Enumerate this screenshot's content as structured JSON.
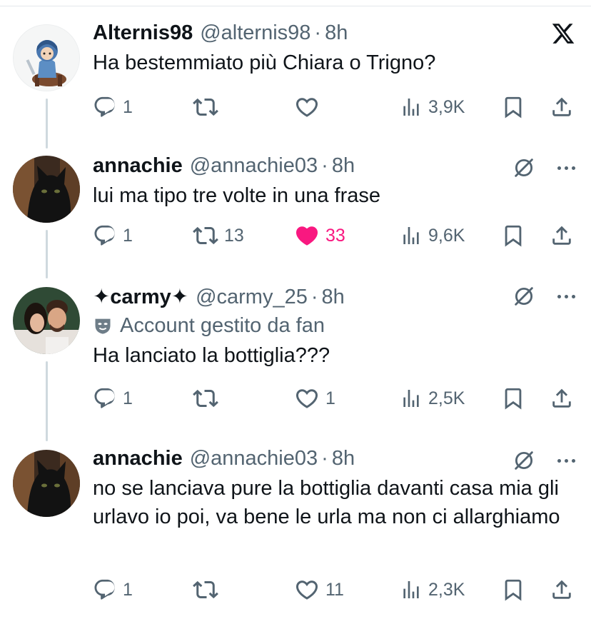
{
  "tweets": [
    {
      "name": "Alternis98",
      "handle": "@alternis98",
      "time": "8h",
      "text": "Ha bestemmiato più Chiara o Trigno?",
      "replies": "1",
      "retweets": "",
      "likes": "",
      "views": "3,9K",
      "liked": false
    },
    {
      "name": "annachie",
      "handle": "@annachie03",
      "time": "8h",
      "text": "lui ma tipo tre volte in una frase",
      "replies": "1",
      "retweets": "13",
      "likes": "33",
      "views": "9,6K",
      "liked": true
    },
    {
      "name": "✦carmy✦",
      "handle": "@carmy_25",
      "time": "8h",
      "fan_label": "Account gestito da fan",
      "text": "Ha lanciato la bottiglia???",
      "replies": "1",
      "retweets": "",
      "likes": "1",
      "views": "2,5K",
      "liked": false
    },
    {
      "name": "annachie",
      "handle": "@annachie03",
      "time": "8h",
      "text": "no se lanciava pure la bottiglia davanti casa mia gli urlavo io poi, va bene le urla ma non ci allarghiamo",
      "replies": "1",
      "retweets": "",
      "likes": "11",
      "views": "2,3K",
      "liked": false
    }
  ],
  "separator": "·",
  "colors": {
    "text": "#0f1419",
    "secondary": "#536471",
    "like": "#f91880",
    "thread": "#cfd9de"
  },
  "icons": [
    "x-logo-icon",
    "reply-icon",
    "retweet-icon",
    "heart-icon",
    "views-icon",
    "bookmark-icon",
    "share-icon",
    "mute-icon",
    "more-icon",
    "fan-mask-icon"
  ]
}
